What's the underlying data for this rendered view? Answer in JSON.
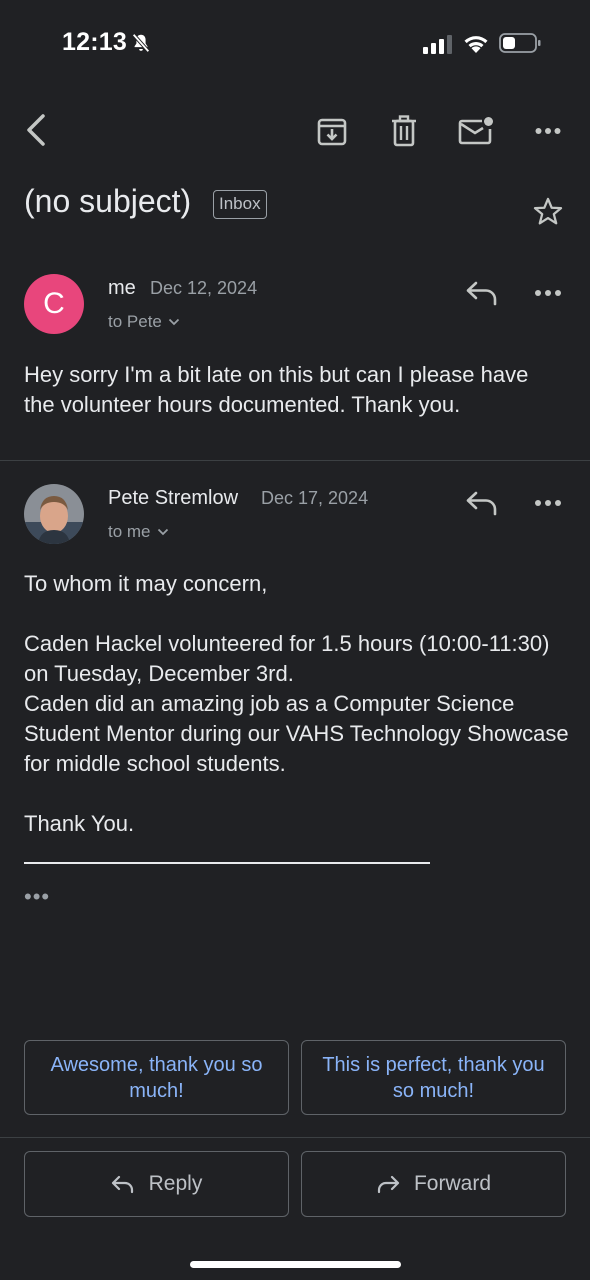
{
  "status_bar": {
    "time": "12:13",
    "icons": [
      "bell-slash-icon",
      "cellular-signal-icon",
      "wifi-icon",
      "battery-icon"
    ]
  },
  "toolbar": {
    "icons": [
      "back-arrow-icon",
      "archive-icon",
      "trash-icon",
      "mark-unread-icon",
      "more-icon"
    ]
  },
  "email": {
    "subject": "(no subject)",
    "label": "Inbox"
  },
  "messages": [
    {
      "avatar_letter": "C",
      "avatar_color": "#e8467c",
      "sender": "me",
      "date": "Dec 12, 2024",
      "to": "to Pete",
      "body": "Hey sorry I'm a bit late on this but can I please have the volunteer hours documented. Thank you."
    },
    {
      "avatar": "profile-photo",
      "sender": "Pete Stremlow",
      "date": "Dec 17, 2024",
      "to": "to me",
      "body": "To whom it may concern,\n\nCaden Hackel volunteered for 1.5 hours (10:00-11:30) on Tuesday, December 3rd.\nCaden did an amazing job as a Computer Science Student Mentor during our VAHS Technology Showcase for middle school students.\n\nThank You.",
      "trimmed_indicator": "•••"
    }
  ],
  "smart_replies": [
    "Awesome, thank you so much!",
    "This is perfect, thank you so much!"
  ],
  "actions": {
    "reply": "Reply",
    "forward": "Forward"
  },
  "colors": {
    "background": "#202124",
    "accent": "#8ab4f8",
    "avatar_me": "#e8467c"
  }
}
